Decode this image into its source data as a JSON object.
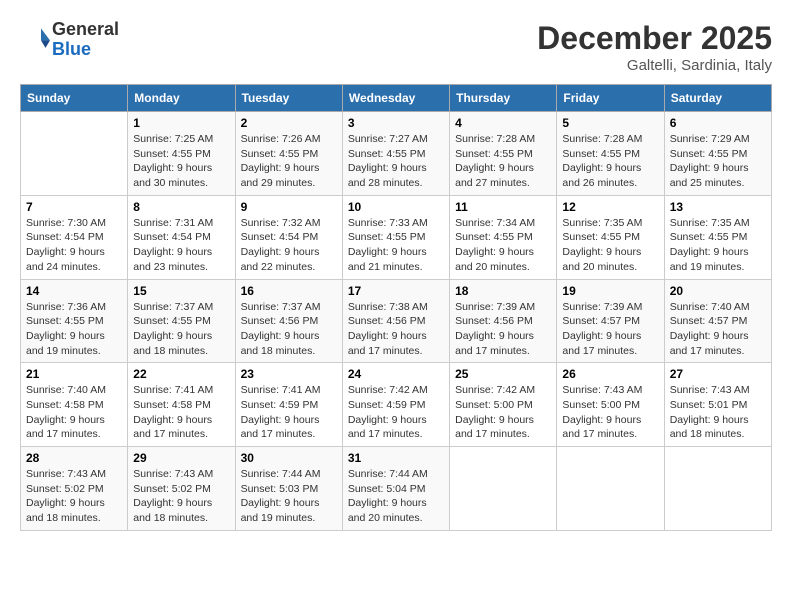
{
  "header": {
    "logo": {
      "general": "General",
      "blue": "Blue"
    },
    "title": "December 2025",
    "location": "Galtelli, Sardinia, Italy"
  },
  "weekdays": [
    "Sunday",
    "Monday",
    "Tuesday",
    "Wednesday",
    "Thursday",
    "Friday",
    "Saturday"
  ],
  "weeks": [
    [
      null,
      {
        "day": "1",
        "sunrise": "7:25 AM",
        "sunset": "4:55 PM",
        "daylight": "9 hours and 30 minutes."
      },
      {
        "day": "2",
        "sunrise": "7:26 AM",
        "sunset": "4:55 PM",
        "daylight": "9 hours and 29 minutes."
      },
      {
        "day": "3",
        "sunrise": "7:27 AM",
        "sunset": "4:55 PM",
        "daylight": "9 hours and 28 minutes."
      },
      {
        "day": "4",
        "sunrise": "7:28 AM",
        "sunset": "4:55 PM",
        "daylight": "9 hours and 27 minutes."
      },
      {
        "day": "5",
        "sunrise": "7:28 AM",
        "sunset": "4:55 PM",
        "daylight": "9 hours and 26 minutes."
      },
      {
        "day": "6",
        "sunrise": "7:29 AM",
        "sunset": "4:55 PM",
        "daylight": "9 hours and 25 minutes."
      }
    ],
    [
      {
        "day": "7",
        "sunrise": "7:30 AM",
        "sunset": "4:54 PM",
        "daylight": "9 hours and 24 minutes."
      },
      {
        "day": "8",
        "sunrise": "7:31 AM",
        "sunset": "4:54 PM",
        "daylight": "9 hours and 23 minutes."
      },
      {
        "day": "9",
        "sunrise": "7:32 AM",
        "sunset": "4:54 PM",
        "daylight": "9 hours and 22 minutes."
      },
      {
        "day": "10",
        "sunrise": "7:33 AM",
        "sunset": "4:55 PM",
        "daylight": "9 hours and 21 minutes."
      },
      {
        "day": "11",
        "sunrise": "7:34 AM",
        "sunset": "4:55 PM",
        "daylight": "9 hours and 20 minutes."
      },
      {
        "day": "12",
        "sunrise": "7:35 AM",
        "sunset": "4:55 PM",
        "daylight": "9 hours and 20 minutes."
      },
      {
        "day": "13",
        "sunrise": "7:35 AM",
        "sunset": "4:55 PM",
        "daylight": "9 hours and 19 minutes."
      }
    ],
    [
      {
        "day": "14",
        "sunrise": "7:36 AM",
        "sunset": "4:55 PM",
        "daylight": "9 hours and 19 minutes."
      },
      {
        "day": "15",
        "sunrise": "7:37 AM",
        "sunset": "4:55 PM",
        "daylight": "9 hours and 18 minutes."
      },
      {
        "day": "16",
        "sunrise": "7:37 AM",
        "sunset": "4:56 PM",
        "daylight": "9 hours and 18 minutes."
      },
      {
        "day": "17",
        "sunrise": "7:38 AM",
        "sunset": "4:56 PM",
        "daylight": "9 hours and 17 minutes."
      },
      {
        "day": "18",
        "sunrise": "7:39 AM",
        "sunset": "4:56 PM",
        "daylight": "9 hours and 17 minutes."
      },
      {
        "day": "19",
        "sunrise": "7:39 AM",
        "sunset": "4:57 PM",
        "daylight": "9 hours and 17 minutes."
      },
      {
        "day": "20",
        "sunrise": "7:40 AM",
        "sunset": "4:57 PM",
        "daylight": "9 hours and 17 minutes."
      }
    ],
    [
      {
        "day": "21",
        "sunrise": "7:40 AM",
        "sunset": "4:58 PM",
        "daylight": "9 hours and 17 minutes."
      },
      {
        "day": "22",
        "sunrise": "7:41 AM",
        "sunset": "4:58 PM",
        "daylight": "9 hours and 17 minutes."
      },
      {
        "day": "23",
        "sunrise": "7:41 AM",
        "sunset": "4:59 PM",
        "daylight": "9 hours and 17 minutes."
      },
      {
        "day": "24",
        "sunrise": "7:42 AM",
        "sunset": "4:59 PM",
        "daylight": "9 hours and 17 minutes."
      },
      {
        "day": "25",
        "sunrise": "7:42 AM",
        "sunset": "5:00 PM",
        "daylight": "9 hours and 17 minutes."
      },
      {
        "day": "26",
        "sunrise": "7:43 AM",
        "sunset": "5:00 PM",
        "daylight": "9 hours and 17 minutes."
      },
      {
        "day": "27",
        "sunrise": "7:43 AM",
        "sunset": "5:01 PM",
        "daylight": "9 hours and 18 minutes."
      }
    ],
    [
      {
        "day": "28",
        "sunrise": "7:43 AM",
        "sunset": "5:02 PM",
        "daylight": "9 hours and 18 minutes."
      },
      {
        "day": "29",
        "sunrise": "7:43 AM",
        "sunset": "5:02 PM",
        "daylight": "9 hours and 18 minutes."
      },
      {
        "day": "30",
        "sunrise": "7:44 AM",
        "sunset": "5:03 PM",
        "daylight": "9 hours and 19 minutes."
      },
      {
        "day": "31",
        "sunrise": "7:44 AM",
        "sunset": "5:04 PM",
        "daylight": "9 hours and 20 minutes."
      },
      null,
      null,
      null
    ]
  ],
  "labels": {
    "sunrise": "Sunrise:",
    "sunset": "Sunset:",
    "daylight": "Daylight:"
  }
}
